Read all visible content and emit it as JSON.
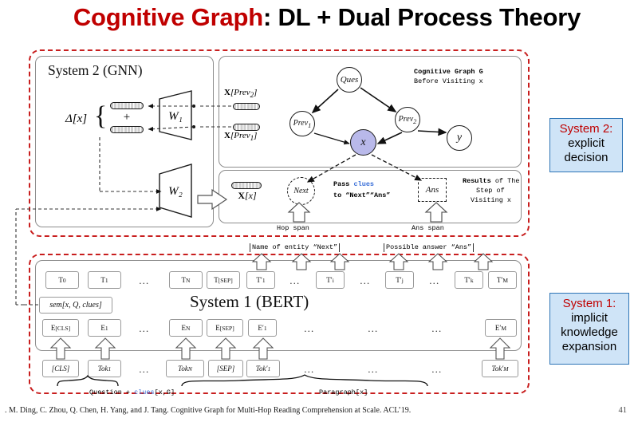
{
  "title": {
    "accent": "Cognitive Graph",
    "rest": ": DL + Dual Process Theory"
  },
  "system2": {
    "panel_title": "System 2 (GNN)",
    "delta_label": "Δ[x]",
    "plus": "+",
    "w1": "W₁",
    "w2": "W₂"
  },
  "graph": {
    "caption_line1": "Cognitive Graph G",
    "caption_line2": "Before Visiting x",
    "x_prev2_label": "X[Prev₂]",
    "x_prev1_label": "X[Prev₁]",
    "nodes": [
      {
        "id": "ques",
        "label": "Ques"
      },
      {
        "id": "prev2",
        "label": "Prev₂"
      },
      {
        "id": "prev1",
        "label": "Prev₁"
      },
      {
        "id": "x",
        "label": "x"
      },
      {
        "id": "y",
        "label": "y"
      }
    ]
  },
  "results": {
    "x_label": "X[x]",
    "next_node": "Next",
    "ans_node": "Ans",
    "pass_pre": "Pass ",
    "pass_clues": "clues",
    "pass_post": "to “Next”“Ans”",
    "caption_bold": "Results",
    "caption_rest": " of The",
    "caption_line2": "Step of",
    "caption_line3": "Visiting x",
    "hop_span": "Hop span",
    "ans_span": "Ans span"
  },
  "bridge": {
    "name_of_entity": "Name of entity “Next”",
    "possible_answer": "Possible answer “Ans”"
  },
  "system1": {
    "panel_title": "System 1 (BERT)",
    "sem_label": "sem[x, Q, clues]",
    "row_T": [
      "T₀",
      "T₁",
      "…",
      "Tₙ",
      "T[SEP]",
      "T′₁",
      "…",
      "T′ᵢ",
      "…",
      "T′ⱼ",
      "…",
      "T′ₖ",
      "T′ₘ"
    ],
    "row_E": [
      "E[CLS]",
      "E₁",
      "…",
      "Eₙ",
      "E[SEP]",
      "E′₁",
      "…",
      "…",
      "…",
      "E′ₘ"
    ],
    "row_Tok": [
      "[CLS]",
      "Tok₁",
      "…",
      "Tokₙ",
      "[SEP]",
      "Tok′₁",
      "…",
      "…",
      "…",
      "Tok′ₘ"
    ],
    "brace_left": "Question + clues[x,G]",
    "brace_left_pre": "Question + ",
    "brace_left_clues": "clues",
    "brace_left_post": "[x,G]",
    "brace_right": "Paragraph[x]"
  },
  "callouts": {
    "sys2_head": "System 2:",
    "sys2_body_l1": "explicit",
    "sys2_body_l2": "decision",
    "sys1_head": "System 1:",
    "sys1_body_l1": "implicit",
    "sys1_body_l2": "knowledge",
    "sys1_body_l3": "expansion"
  },
  "footer": {
    "citation": ".  M. Ding, C. Zhou, Q. Chen, H. Yang, and J. Tang. Cognitive Graph for Multi-Hop Reading Comprehension at Scale. ACL’19.",
    "page": "41"
  },
  "colors": {
    "accent_red": "#c00000",
    "dashed_red": "#c81e1e",
    "node_fill": "#b9b9ea",
    "callout_fill": "#cfe4f7",
    "callout_border": "#2e75b6",
    "clues_blue": "#3a6fd8"
  }
}
